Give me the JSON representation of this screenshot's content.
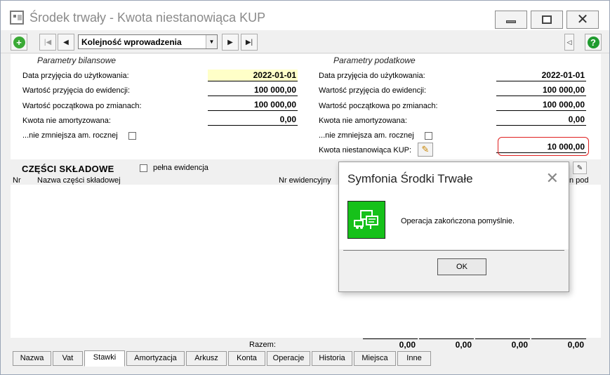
{
  "window": {
    "title": "Środek trwały - Kwota niestanowiąca KUP"
  },
  "toolbar": {
    "order_value": "Kolejność wprowadzenia"
  },
  "bilansowe": {
    "title": "Parametry bilansowe",
    "rows": [
      {
        "label": "Data przyjęcia do użytkowania:",
        "value": "2022-01-01"
      },
      {
        "label": "Wartość przyjęcia do ewidencji:",
        "value": "100 000,00"
      },
      {
        "label": "Wartość początkowa po zmianach:",
        "value": "100 000,00"
      },
      {
        "label": "Kwota nie amortyzowana:",
        "value": "0,00"
      }
    ],
    "checkbox_label": "...nie zmniejsza am. rocznej"
  },
  "podatkowe": {
    "title": "Parametry podatkowe",
    "rows": [
      {
        "label": "Data przyjęcia do użytkowania:",
        "value": "2022-01-01"
      },
      {
        "label": "Wartość przyjęcia do ewidencji:",
        "value": "100 000,00"
      },
      {
        "label": "Wartość początkowa po zmianach:",
        "value": "100 000,00"
      },
      {
        "label": "Kwota nie amortyzowana:",
        "value": "0,00"
      }
    ],
    "checkbox_label": "...nie zmniejsza am. rocznej",
    "kup_label": "Kwota niestanowiąca KUP:",
    "kup_value": "10 000,00"
  },
  "parts": {
    "title": "CZĘŚCI SKŁADOWE",
    "full_label": "pełna ewidencja",
    "columns": {
      "nr": "Nr",
      "name": "Nazwa części składowej",
      "evid": "Nr ewidencyjny",
      "last": "n pod"
    },
    "sum_label": "Razem:",
    "sums": [
      "0,00",
      "0,00",
      "0,00",
      "0,00"
    ]
  },
  "tabs": [
    "Nazwa",
    "Vat",
    "Stawki",
    "Amortyzacja",
    "Arkusz",
    "Konta",
    "Operacje",
    "Historia",
    "Miejsca",
    "Inne"
  ],
  "active_tab": "Stawki",
  "dialog": {
    "title": "Symfonia Środki Trwałe",
    "message": "Operacja zakończona pomyślnie.",
    "ok_label": "OK"
  },
  "colors": {
    "highlight": "#e02020",
    "date_bg": "#ffffc8",
    "success_icon": "#16c11a",
    "add_icon": "#3aaa35",
    "help_icon": "#1f9b2f"
  }
}
